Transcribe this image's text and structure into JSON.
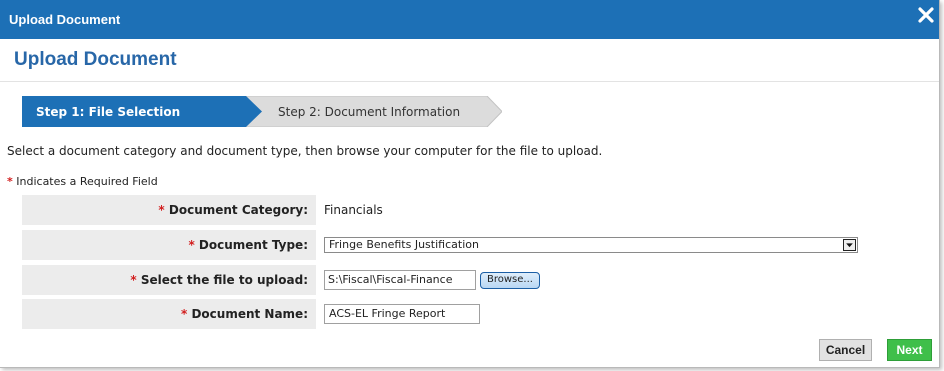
{
  "dialog": {
    "title": "Upload Document",
    "heading": "Upload Document"
  },
  "steps": [
    {
      "label": "Step 1: File Selection",
      "active": true
    },
    {
      "label": "Step 2: Document Information",
      "active": false
    }
  ],
  "instruction": "Select a document category and document type, then browse your computer for the file to upload.",
  "required_note": "Indicates a Required Field",
  "form": {
    "category_label": "Document Category:",
    "category_value": "Financials",
    "type_label": "Document Type:",
    "type_value": "Fringe Benefits Justification",
    "file_label": "Select the file to upload:",
    "file_value": "S:\\Fiscal\\Fiscal-Finance",
    "browse_label": "Browse...",
    "name_label": "Document Name:",
    "name_value": "ACS-EL Fringe Report"
  },
  "buttons": {
    "cancel": "Cancel",
    "next": "Next"
  },
  "colors": {
    "titlebar": "#1d70b6",
    "active_step": "#1d70b6",
    "inactive_step": "#dcdcdc",
    "required_star": "#d21e1e",
    "next_button": "#3fbf4a"
  },
  "icons": {
    "close": "close-icon",
    "dropdown": "chevron-down-icon"
  }
}
